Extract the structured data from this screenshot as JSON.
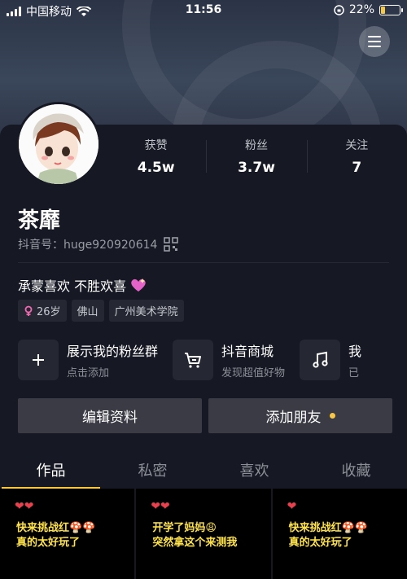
{
  "status_bar": {
    "carrier": "中国移动",
    "time": "11:56",
    "battery": "22%",
    "battery_level": 0.22
  },
  "profile": {
    "name": "茶靡",
    "account": "抖音号：huge920920614",
    "stats": [
      {
        "label": "获赞",
        "value": "4.5w"
      },
      {
        "label": "粉丝",
        "value": "3.7w"
      },
      {
        "label": "关注",
        "value": "7"
      }
    ],
    "bio": "承蒙喜欢 不胜欢喜",
    "tags": [
      {
        "text": "26岁",
        "icon": "female-icon"
      },
      {
        "text": "佛山"
      },
      {
        "text": "广州美术学院"
      }
    ]
  },
  "features": [
    {
      "title": "展示我的粉丝群",
      "subtitle": "点击添加",
      "icon": "plus-icon"
    },
    {
      "title": "抖音商城",
      "subtitle": "发现超值好物",
      "icon": "cart-icon"
    },
    {
      "title": "我",
      "subtitle": "已",
      "icon": "music-icon"
    }
  ],
  "actions": {
    "edit_label": "编辑资料",
    "add_friend_label": "添加朋友"
  },
  "tabs": [
    {
      "label": "作品",
      "active": true
    },
    {
      "label": "私密"
    },
    {
      "label": "喜欢"
    },
    {
      "label": "收藏"
    }
  ],
  "videos": [
    {
      "caption": "快来挑战红🍄🍄\n真的太好玩了"
    },
    {
      "caption": "开学了妈妈😩\n突然拿这个来测我"
    },
    {
      "caption": "快来挑战红🍄🍄\n真的太好玩了"
    }
  ],
  "colors": {
    "background": "#161823",
    "accent": "#f7c744",
    "button": "#3a3b44"
  }
}
